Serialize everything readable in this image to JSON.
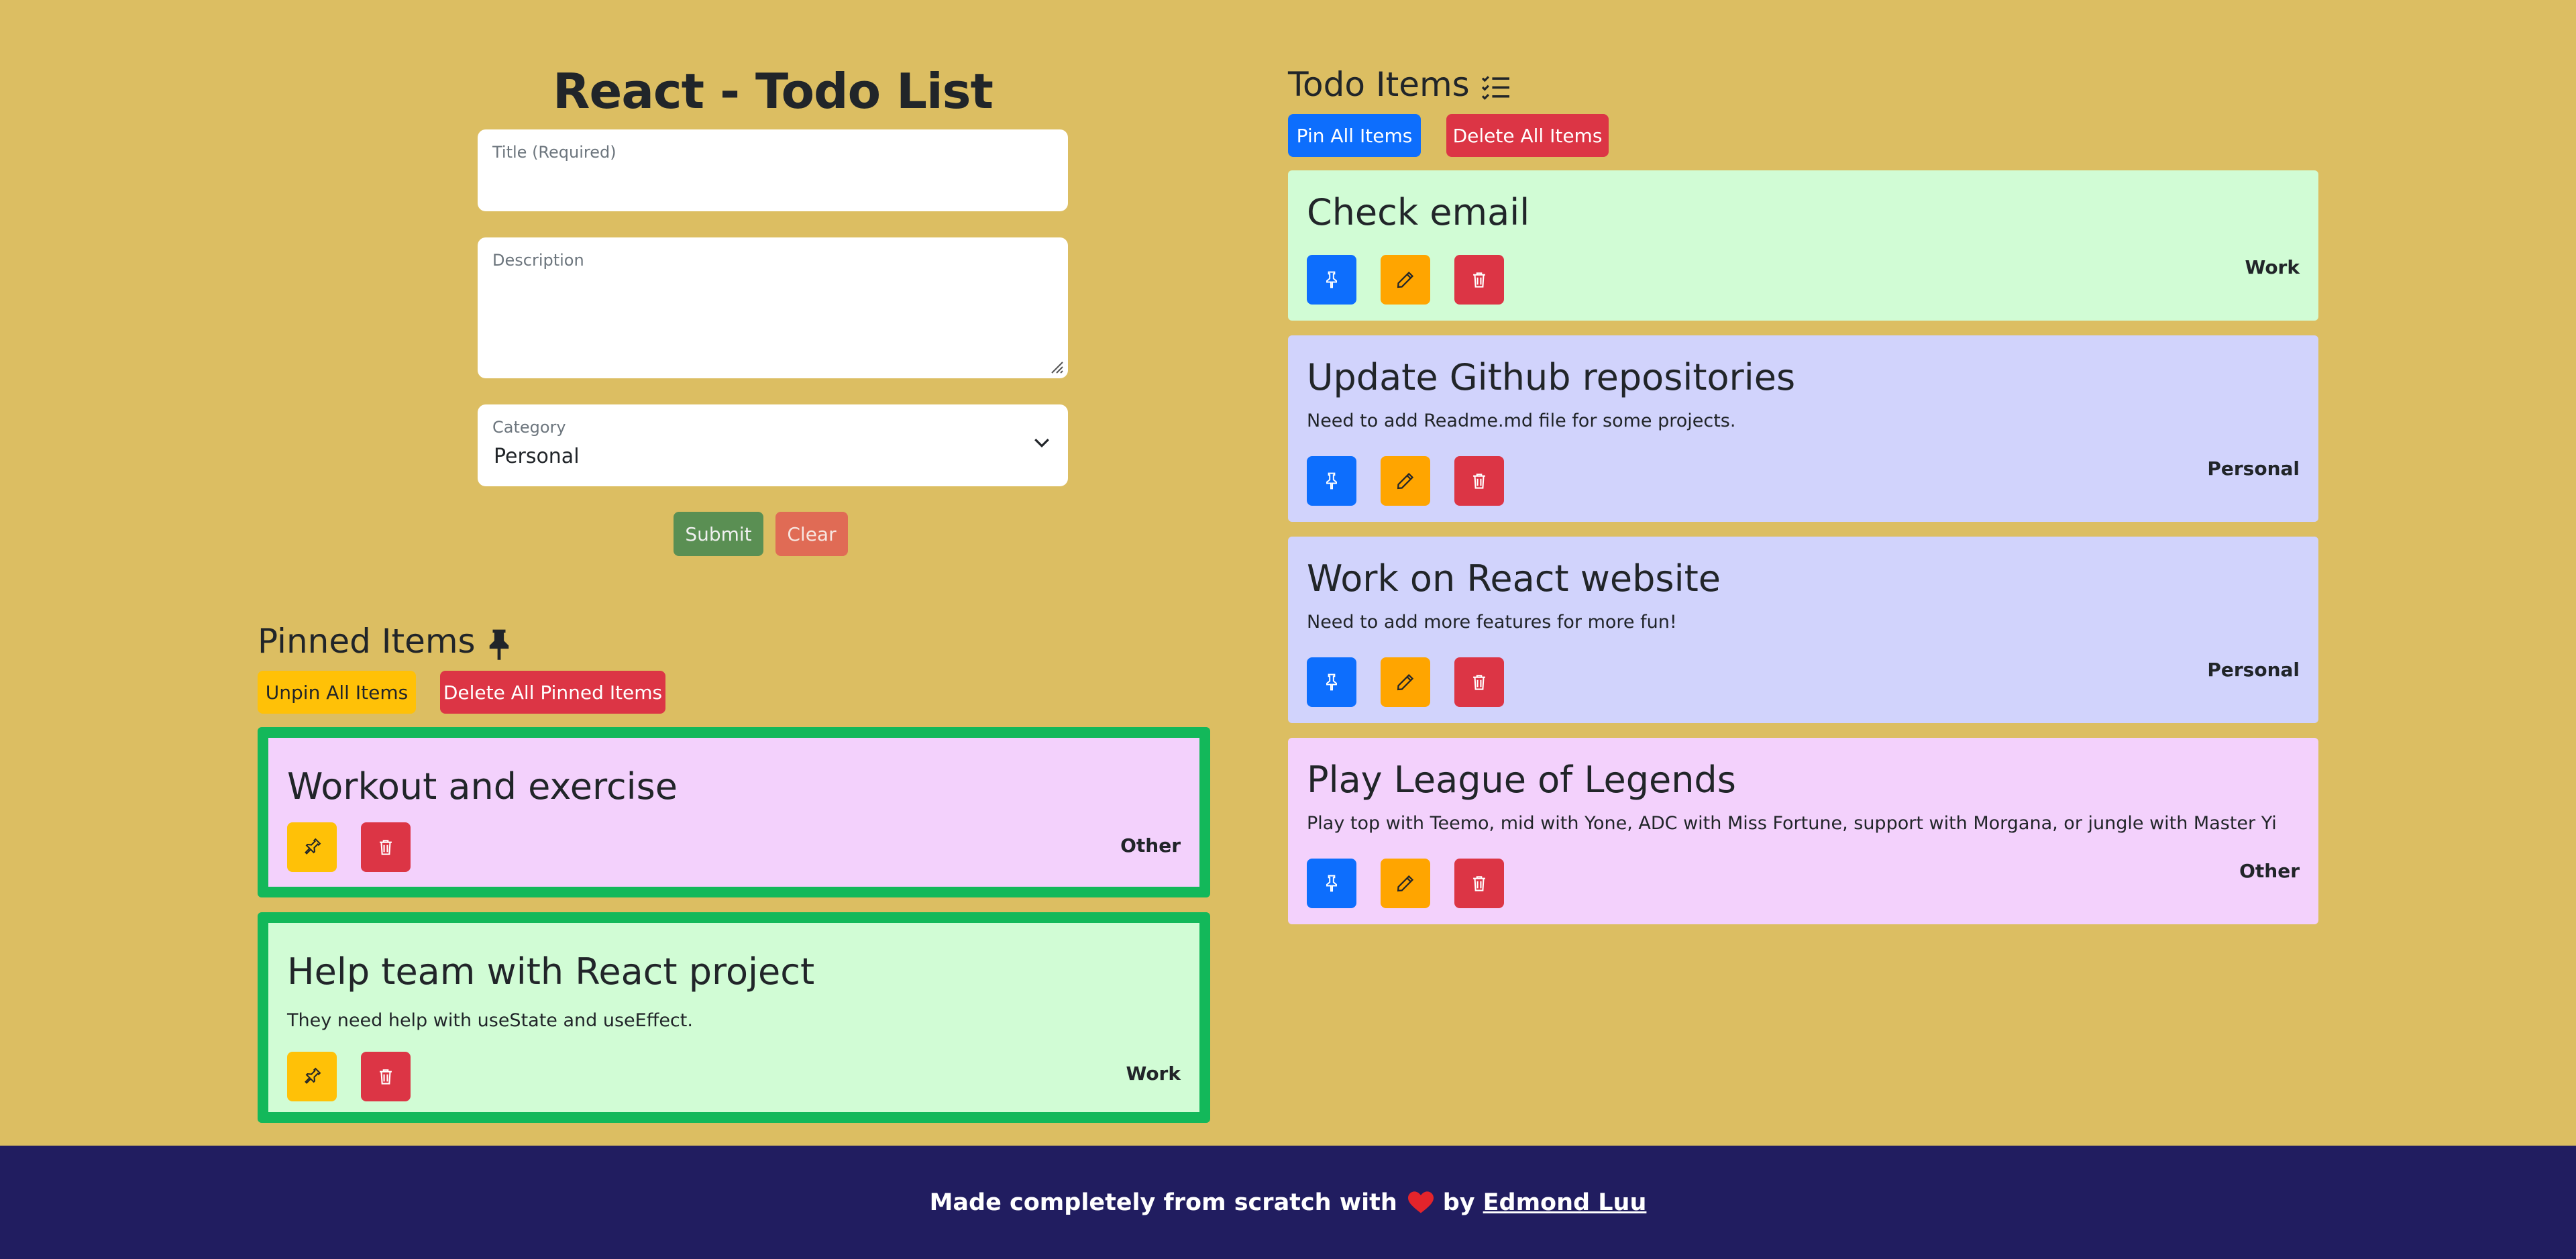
{
  "app": {
    "title": "React - Todo List"
  },
  "form": {
    "title_label": "Title (Required)",
    "description_label": "Description",
    "category_label": "Category",
    "category_value": "Personal",
    "submit_label": "Submit",
    "clear_label": "Clear"
  },
  "pinned": {
    "heading": "Pinned Items",
    "unpin_all_label": "Unpin All Items",
    "delete_all_label": "Delete All Pinned Items",
    "items": [
      {
        "title": "Workout and exercise",
        "description": "",
        "category": "Other"
      },
      {
        "title": "Help team with React project",
        "description": "They need help with useState and useEffect.",
        "category": "Work"
      }
    ]
  },
  "todos": {
    "heading": "Todo Items",
    "pin_all_label": "Pin All Items",
    "delete_all_label": "Delete All Items",
    "items": [
      {
        "title": "Check email",
        "description": "",
        "category": "Work"
      },
      {
        "title": "Update Github repositories",
        "description": "Need to add Readme.md file for some projects.",
        "category": "Personal"
      },
      {
        "title": "Work on React website",
        "description": "Need to add more features for more fun!",
        "category": "Personal"
      },
      {
        "title": "Play League of Legends",
        "description": "Play top with Teemo, mid with Yone, ADC with Miss Fortune, support with Morgana, or jungle with Master Yi",
        "category": "Other"
      }
    ]
  },
  "footer": {
    "text_before": "Made completely from scratch with",
    "text_by": "by",
    "author": "Edmond Luu"
  },
  "colors": {
    "page_bg": "#dcbe62",
    "footer_bg": "#211d60",
    "work": "#d1fcd5",
    "personal": "#d1d3fc",
    "other": "#f3d1fc",
    "pinned_border": "#13b85a"
  },
  "icons": {
    "pin": "pin-icon",
    "edit": "pencil-icon",
    "delete": "trash-icon",
    "list": "list-check-icon",
    "heart": "heart-icon"
  }
}
